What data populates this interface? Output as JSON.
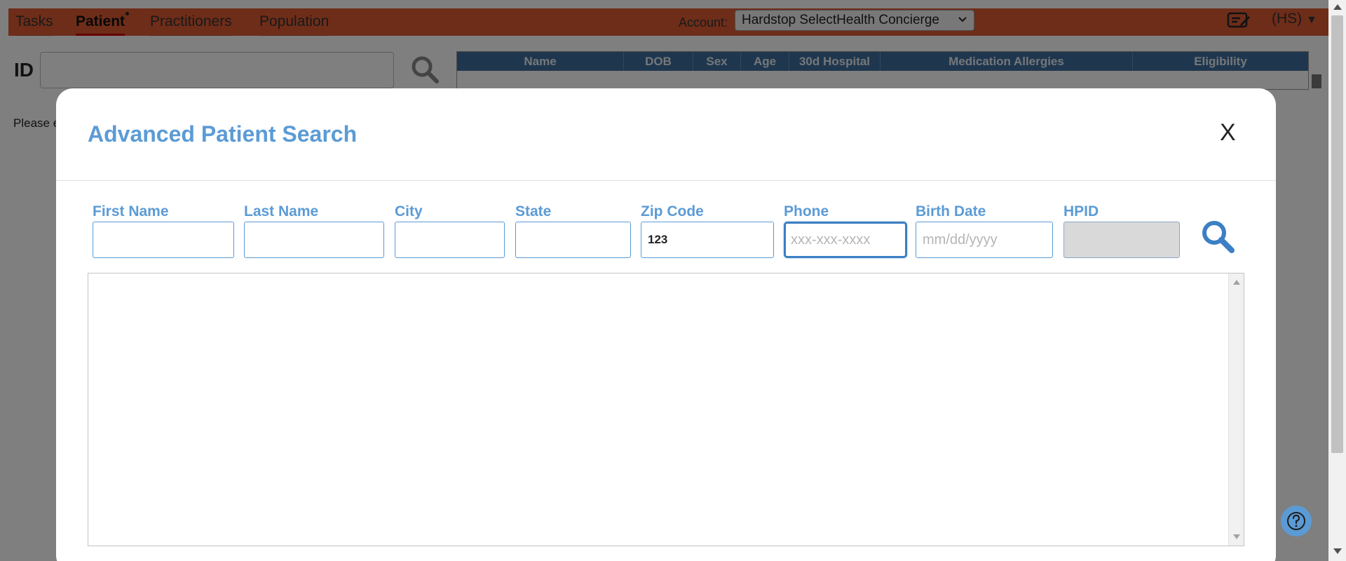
{
  "nav": {
    "tabs": [
      {
        "label": "Tasks",
        "active": false
      },
      {
        "label": "Patient",
        "active": true,
        "has_indicator": true
      },
      {
        "label": "Practitioners",
        "active": false
      },
      {
        "label": "Population",
        "active": false
      }
    ],
    "account_label": "Account:",
    "account_value": "Hardstop SelectHealth Concierge",
    "user_initials": "(HS)",
    "bar_color": "#dc5b33"
  },
  "background_page": {
    "id_label": "ID",
    "id_input_value": "",
    "results_columns": [
      "Name",
      "DOB",
      "Sex",
      "Age",
      "30d Hospital",
      "Medication Allergies",
      "Eligibility"
    ],
    "hint_text": "Please e"
  },
  "modal": {
    "title": "Advanced Patient Search",
    "close_label": "X",
    "accent_color": "#5b9bd5",
    "fields": [
      {
        "key": "first_name",
        "label": "First Name",
        "value": "",
        "placeholder": ""
      },
      {
        "key": "last_name",
        "label": "Last Name",
        "value": "",
        "placeholder": ""
      },
      {
        "key": "city",
        "label": "City",
        "value": "",
        "placeholder": ""
      },
      {
        "key": "state",
        "label": "State",
        "value": "",
        "placeholder": ""
      },
      {
        "key": "zip_code",
        "label": "Zip Code",
        "value": "123",
        "placeholder": ""
      },
      {
        "key": "phone",
        "label": "Phone",
        "value": "",
        "placeholder": "xxx-xxx-xxxx",
        "focused": true
      },
      {
        "key": "birth_date",
        "label": "Birth Date",
        "value": "",
        "placeholder": "mm/dd/yyyy"
      },
      {
        "key": "hpid",
        "label": "HPID",
        "value": "",
        "placeholder": "",
        "disabled": true
      }
    ],
    "results": []
  },
  "help_button_icon": "question-circle-icon"
}
